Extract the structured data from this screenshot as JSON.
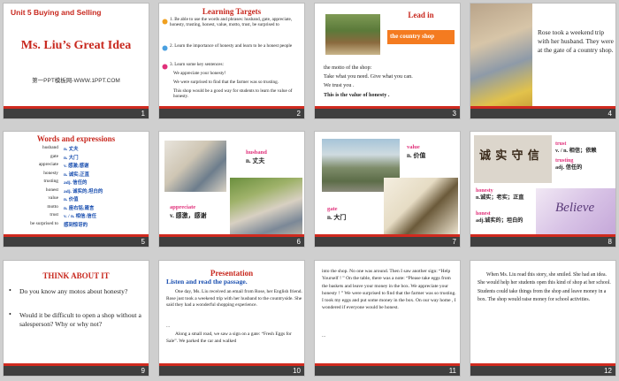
{
  "slides": [
    {
      "num": "1",
      "unit": "Unit 5  Buying and Selling",
      "title": "Ms. Liu’s Great Idea",
      "footer": "第一PPT模板网-WWW.1PPT.COM"
    },
    {
      "num": "2",
      "title": "Learning Targets",
      "items": [
        "1. Be able to use the words and phrases: husband, gate, appreciate, honesty, trusting, honest, value, motto, trust, be surprised to",
        "2. Learn the importance of honesty and learn to be a honest people",
        "3. Learn some key sentences:",
        "We appreciate your honesty!",
        "We were surprised to find that the farmer was so trusting.",
        "This shop would be a good way for students to learn the value of honesty."
      ]
    },
    {
      "num": "3",
      "title": "Lead in",
      "banner": "the country shop",
      "lines": [
        "the motto of the shop:",
        "Take what you need.  Give what you can.",
        "We trust you .",
        "This is the value of honesty ."
      ]
    },
    {
      "num": "4",
      "text": "Rose took a weekend trip with her husband. They were at the gate of a country shop."
    },
    {
      "num": "5",
      "title": "Words and expressions",
      "rows": [
        [
          "husband",
          "n. 丈夫"
        ],
        [
          "gate",
          "n. 大门"
        ],
        [
          "appreciate",
          "v. 感激;感谢"
        ],
        [
          "honesty",
          "n. 诚实;正直"
        ],
        [
          "trusting",
          "adj. 信任的"
        ],
        [
          "honest",
          "adj. 诚实的;坦白的"
        ],
        [
          "value",
          "n. 价值"
        ],
        [
          "motto",
          "n. 座右铭;箴言"
        ],
        [
          "trust",
          "v. / n. 相信;信任"
        ],
        [
          "be surprised to",
          "感到惊讶的"
        ]
      ]
    },
    {
      "num": "6",
      "w1": "husband",
      "m1": "n. 丈夫",
      "w2": "appreciate",
      "m2": "v. 感激，感谢"
    },
    {
      "num": "7",
      "w1": "value",
      "m1": "n. 价值",
      "w2": "gate",
      "m2": "n. 大门"
    },
    {
      "num": "8",
      "w1": "trust",
      "m1": "v. / n. 相信；依赖",
      "w2": "trusting",
      "m2": "adj. 信任的",
      "w3": "honesty",
      "m3": "n.诚实；老实；正直",
      "w4": "honest",
      "m4": "adj.诚实的；坦白的",
      "art": "诚 实 守 信",
      "believe": "Believe"
    },
    {
      "num": "9",
      "title": "THINK ABOUT IT",
      "q1": "Do you know any motos about honesty?",
      "q2": "Would it be difficult  to open a shop without a salesperson? Why or why not?"
    },
    {
      "num": "10",
      "title": "Presentation",
      "sub": "Listen and read the passage.",
      "p1": "One day, Ms. Liu received an email from Rose, her English friend. Rose just took a weekend trip with her husband to the countryside. She said they had a wonderful shopping experience.",
      "p2": "...",
      "p3": "Along a small road, we saw a sign on a gate: “Fresh Eggs for Sale”. We parked the car and walked"
    },
    {
      "num": "11",
      "text": "into the shop. No one was around. Then I saw another sign: “Help Yourself ! ” On the table, there was a note: “Please take eggs from the baskets and leave your money in the box. We appreciate your honesty ! ” We were surprised to find that the farmer was so trusting. I took my eggs and put some money in the box. On our way home , I wondered if everyone would be honest.",
      "more": "..."
    },
    {
      "num": "12",
      "text": "When Ms. Liu read this story, she smiled. She had an idea. She would help her students open this kind of shop at her school. Students could take things from the shop and leave money in a box. The shop would raise money for school activities."
    }
  ],
  "colors": {
    "title_red": "#c8281e",
    "accent_pink": "#e0307a",
    "bar": "#3f3f3f",
    "lead_orange": "#f47b20"
  }
}
